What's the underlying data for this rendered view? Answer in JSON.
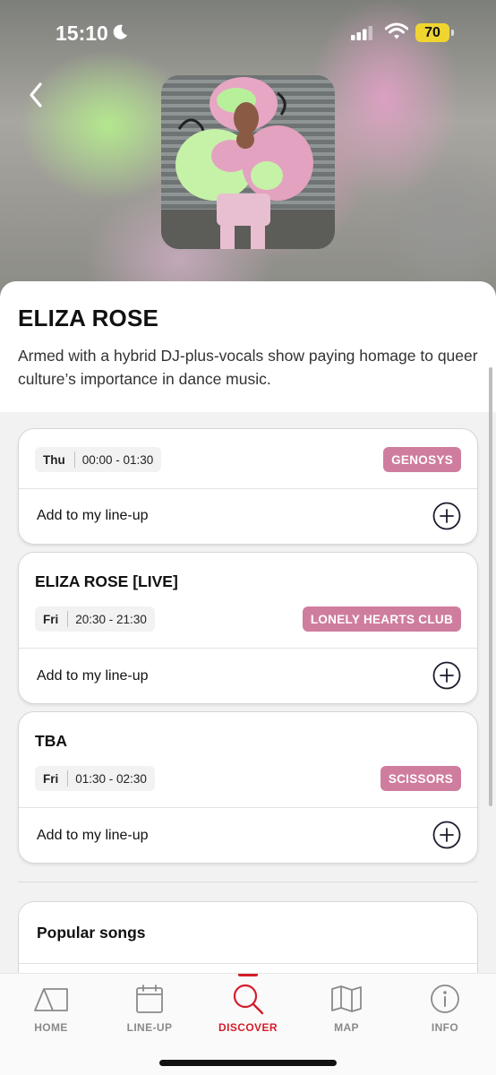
{
  "status_bar": {
    "time": "15:10",
    "battery": "70"
  },
  "artist": {
    "name": "ELIZA ROSE",
    "bio": "Armed with a hybrid DJ-plus-vocals show paying homage to queer culture’s importance in dance music."
  },
  "performances": [
    {
      "title": "",
      "day": "Thu",
      "hours": "00:00 - 01:30",
      "stage": "GENOSYS",
      "action": "Add to my line-up"
    },
    {
      "title": "ELIZA ROSE [LIVE]",
      "day": "Fri",
      "hours": "20:30 - 21:30",
      "stage": "LONELY HEARTS CLUB",
      "action": "Add to my line-up"
    },
    {
      "title": "TBA",
      "day": "Fri",
      "hours": "01:30 - 02:30",
      "stage": "SCISSORS",
      "action": "Add to my line-up"
    }
  ],
  "popular": {
    "title": "Popular songs"
  },
  "tabs": [
    {
      "label": "HOME",
      "icon": "tent-icon"
    },
    {
      "label": "LINE-UP",
      "icon": "calendar-icon"
    },
    {
      "label": "DISCOVER",
      "icon": "search-icon"
    },
    {
      "label": "MAP",
      "icon": "map-icon"
    },
    {
      "label": "INFO",
      "icon": "info-icon"
    }
  ],
  "active_tab": "DISCOVER",
  "colors": {
    "accent": "#d31d2b",
    "stage_badge": "#cf7d9e",
    "battery": "#f0d531"
  }
}
